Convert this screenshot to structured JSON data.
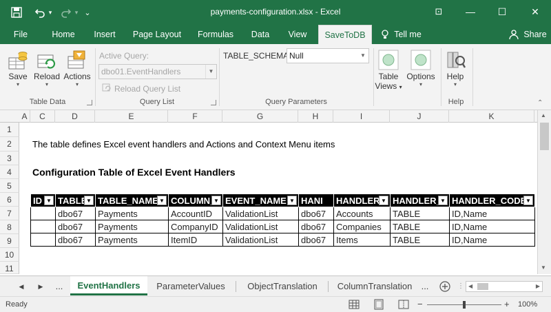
{
  "window": {
    "title": "payments-configuration.xlsx  -  Excel",
    "qat_more": "⌄",
    "minimize": "—",
    "maximize": "☐",
    "close": "✕",
    "ribbon_toggle": "⊡"
  },
  "tabs": [
    {
      "label": "File"
    },
    {
      "label": "Home"
    },
    {
      "label": "Insert"
    },
    {
      "label": "Page Layout"
    },
    {
      "label": "Formulas"
    },
    {
      "label": "Data"
    },
    {
      "label": "View"
    },
    {
      "label": "SaveToDB"
    },
    {
      "label": "Tell me"
    }
  ],
  "share_label": "Share",
  "ribbon": {
    "save": "Save",
    "reload": "Reload",
    "actions": "Actions",
    "group_table_data": "Table Data",
    "active_query_label": "Active Query:",
    "active_query_value": "dbo01.EventHandlers",
    "reload_query_list": "Reload Query List",
    "group_query_list": "Query List",
    "table_schema_label": "TABLE_SCHEMA:",
    "table_schema_value": "Null",
    "group_query_parameters": "Query Parameters",
    "table_views_line1": "Table",
    "table_views_line2": "Views",
    "options": "Options",
    "help": "Help",
    "group_help": "Help"
  },
  "columns": [
    "A",
    "C",
    "D",
    "E",
    "F",
    "G",
    "H",
    "I",
    "J",
    "K"
  ],
  "rows": [
    "1",
    "2",
    "3",
    "4",
    "5",
    "6",
    "7",
    "8",
    "9",
    "10",
    "11"
  ],
  "sheet": {
    "description": "The table defines Excel event handlers and Actions and Context Menu items",
    "heading": "Configuration Table of Excel Event Handlers",
    "headers": [
      "ID",
      "TABLE",
      "TABLE_NAME",
      "COLUMN_",
      "EVENT_NAME",
      "HANI",
      "HANDLER_",
      "HANDLER_",
      "HANDLER_CODE"
    ],
    "data": [
      [
        "",
        "dbo67",
        "Payments",
        "AccountID",
        "ValidationList",
        "dbo67",
        "Accounts",
        "TABLE",
        "ID,Name"
      ],
      [
        "",
        "dbo67",
        "Payments",
        "CompanyID",
        "ValidationList",
        "dbo67",
        "Companies",
        "TABLE",
        "ID,Name"
      ],
      [
        "",
        "dbo67",
        "Payments",
        "ItemID",
        "ValidationList",
        "dbo67",
        "Items",
        "TABLE",
        "ID,Name"
      ]
    ]
  },
  "sheet_tabs": {
    "ellipsis": "...",
    "tabs": [
      "EventHandlers",
      "ParameterValues",
      "ObjectTranslation",
      "ColumnTranslation"
    ],
    "more": "..."
  },
  "status": {
    "ready": "Ready",
    "zoom": "100%"
  },
  "colors": {
    "accent": "#217346"
  }
}
